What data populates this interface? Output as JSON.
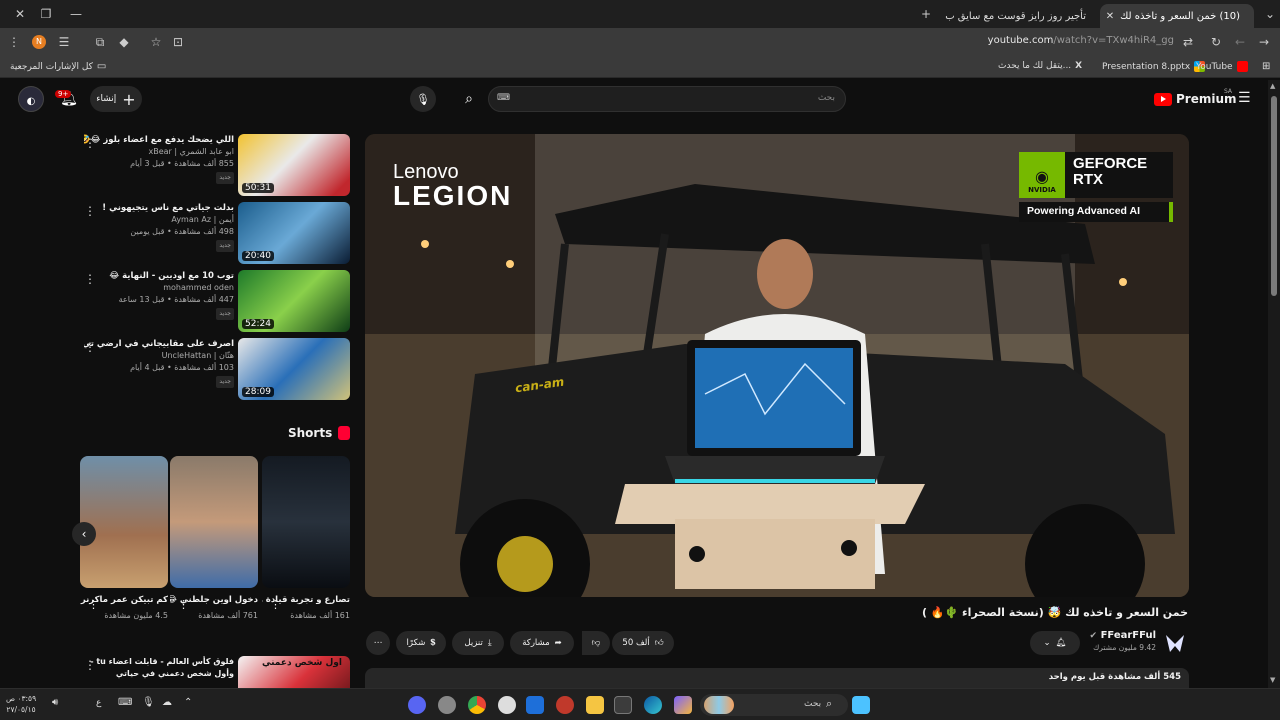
{
  "browser": {
    "tabs": [
      {
        "title": "(10) خمن السعر و تاخذه لك",
        "active": true
      },
      {
        "title": "تأجير روز رايز قوست مع سايق ب",
        "active": false
      }
    ],
    "url_host": "youtube.com",
    "url_path": "/watch?v=TXw4hiR4_gg",
    "profile_initial": "N"
  },
  "bookmarks": {
    "all_bookmarks": "كل الإشارات المرجعية",
    "items": [
      {
        "label": "YouTube",
        "icon": "youtube-icon"
      },
      {
        "label": "Presentation 8.pptx",
        "icon": "office-icon"
      },
      {
        "label": "يتقل لك ما يحدث...",
        "icon": "x-icon"
      }
    ]
  },
  "youtube": {
    "brand": "Premium",
    "region": "SA",
    "search_placeholder": "بحث",
    "create_label": "إنشاء",
    "notif_count": "9+"
  },
  "player": {
    "brand_top": "Lenovo",
    "brand_bottom": "LEGION",
    "gpu_line1": "GEFORCE",
    "gpu_line2": "RTX",
    "gpu_tagline": "Powering Advanced AI",
    "vendor": "NVIDIA",
    "vehicle_brand": "can-am"
  },
  "video": {
    "title": "خمن السعر و تاخذه لك 🤯 (نسخة الصحراء 🌵🔥 )",
    "channel": "FFearFFul",
    "subscribers": "9.42 مليون مشترك",
    "likes": "50 ألف",
    "share": "مشاركة",
    "download": "تنزيل",
    "thanks": "شكرًا",
    "views_line": "545 ألف مشاهدة  قبل يوم واحد"
  },
  "recommendations": [
    {
      "title": "اللي يضحك يدفع مع اعضاء بلوز 😂🤣",
      "channel": "ابو عابد الشمري | xBear",
      "stats": "855 ألف مشاهدة • قبل 3 أيام",
      "duration": "50:31",
      "badge": "جديد"
    },
    {
      "title": "بدلت جياتي مع ناس يتجيهوني !",
      "channel": "أيمن | Ayman Az",
      "stats": "498 ألف مشاهدة • قبل يومين",
      "duration": "20:40",
      "badge": "جديد"
    },
    {
      "title": "توب 10 مع اوديين - النهاية 😂",
      "channel": "mohammed oden",
      "stats": "447 ألف مشاهدة • قبل 13 ساعة",
      "duration": "52:24",
      "badge": "جديد"
    },
    {
      "title": "اصرف على مقابيجاني في ارضي تي في 😂",
      "channel": "هتّان | UncleHattan",
      "stats": "103 ألف مشاهدة • قبل 4 أيام",
      "duration": "28:09",
      "badge": "جديد"
    }
  ],
  "shorts": {
    "heading": "Shorts",
    "items": [
      {
        "title": "كم تبيكن عمر ماكرنر ب 034...",
        "views": "4.5 مليون مشاهدة"
      },
      {
        "title": "دخول اوين جلطني 😂😂",
        "views": "761 ألف مشاهدة"
      },
      {
        "title": "تصارع و تجربة قيادة هيونداي ...",
        "views": "161 ألف مشاهدة"
      }
    ]
  },
  "next_rec": {
    "title": "فلوق كأس العالم - قابلت اعضاء tu - وأول شخص دعمني في حياتي",
    "thumb_text": "اول شخص دعمني"
  },
  "taskbar": {
    "search_label": "بحث",
    "clock_time": "٠٣:٥٩ ص",
    "clock_date": "٢٧/٠٥/١٥",
    "lang": "ع"
  }
}
